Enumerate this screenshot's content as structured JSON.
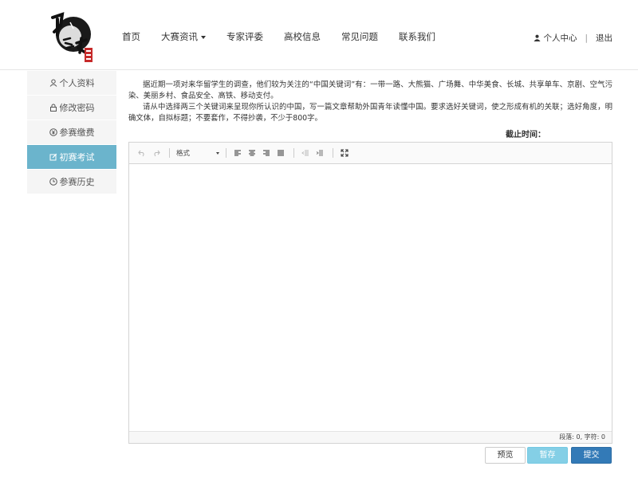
{
  "header": {
    "nav": [
      {
        "label": "首页"
      },
      {
        "label": "大赛资讯",
        "has_dropdown": true
      },
      {
        "label": "专家评委"
      },
      {
        "label": "高校信息"
      },
      {
        "label": "常见问题"
      },
      {
        "label": "联系我们"
      }
    ],
    "user_center": "个人中心",
    "separator": "|",
    "logout": "退出"
  },
  "sidebar": {
    "items": [
      {
        "label": "个人资料",
        "icon": "user-icon",
        "active": false
      },
      {
        "label": "修改密码",
        "icon": "lock-icon",
        "active": false
      },
      {
        "label": "参赛缴费",
        "icon": "yen-circle-icon",
        "active": false
      },
      {
        "label": "初赛考试",
        "icon": "edit-icon",
        "active": true
      },
      {
        "label": "参赛历史",
        "icon": "clock-icon",
        "active": false
      }
    ],
    "active_color": "#6bb4cc"
  },
  "prompt": {
    "paragraph1": "据近期一项对来华留学生的调查，他们较为关注的“中国关键词”有：一带一路、大熊猫、广场舞、中华美食、长城、共享单车、京剧、空气污染、美丽乡村、食品安全、高铁、移动支付。",
    "paragraph2": "请从中选择两三个关键词来呈现你所认识的中国，写一篇文章帮助外国青年读懂中国。要求选好关键词，使之形成有机的关联；选好角度，明确文体，自拟标题；不要套作，不得抄袭，不少于800字。"
  },
  "deadline": {
    "label": "截止时间："
  },
  "editor": {
    "format_select": "格式",
    "status": "段落: 0, 字符: 0"
  },
  "buttons": {
    "preview": "预览",
    "save": "暂存",
    "submit": "提交"
  }
}
